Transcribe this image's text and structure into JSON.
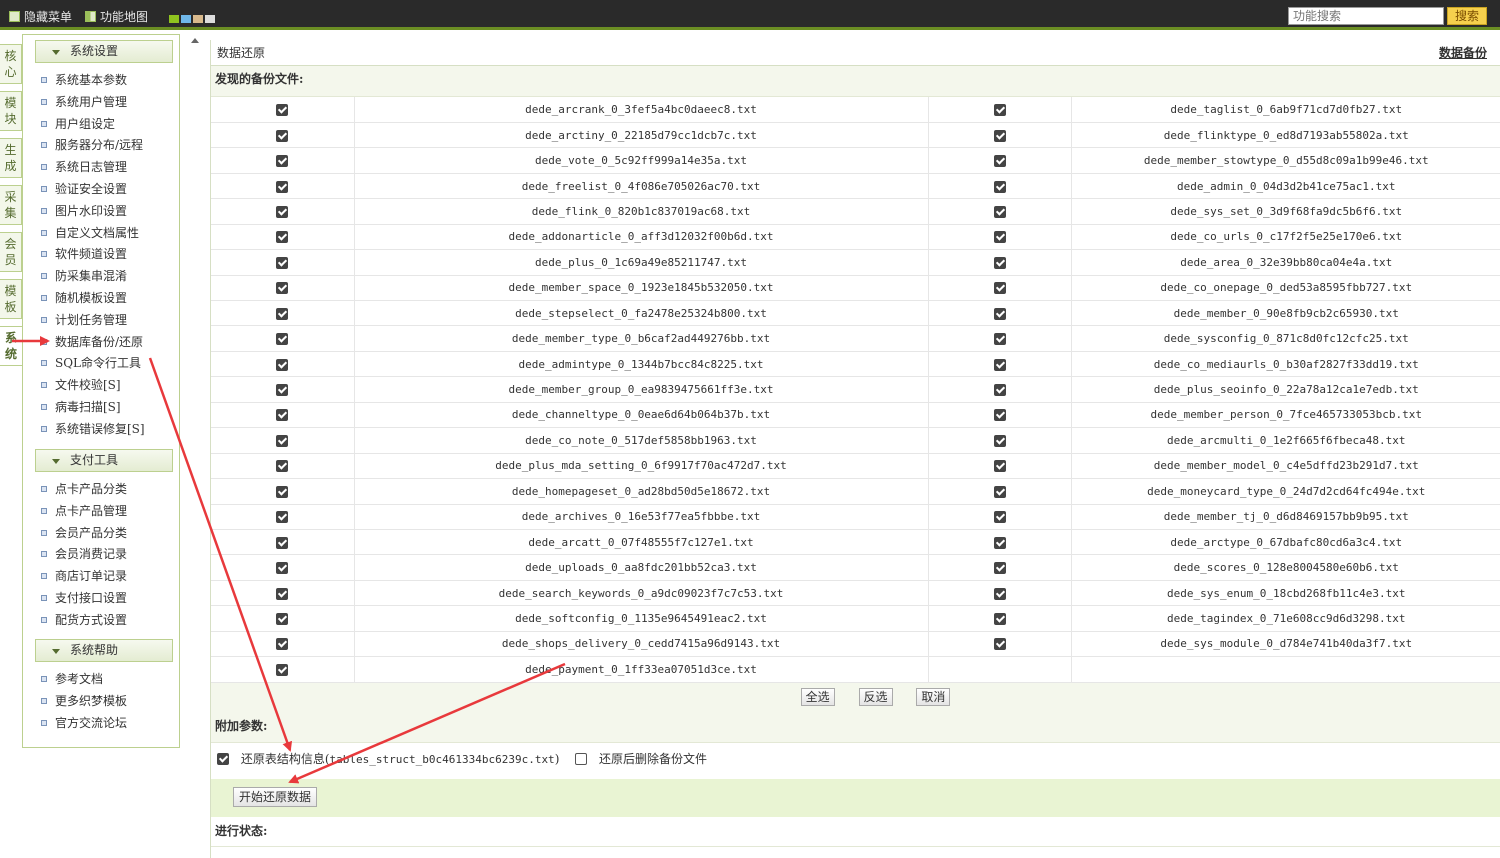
{
  "topbar": {
    "hide_menu": "隐藏菜单",
    "function_map": "功能地图",
    "search_placeholder": "功能搜索",
    "search_button": "搜索",
    "skin_colors": [
      "#8fc31f",
      "#6fb7e9",
      "#d8b98c",
      "#dddddd"
    ]
  },
  "vtabs": [
    "核心",
    "模块",
    "生成",
    "采集",
    "会员",
    "模板",
    "系统"
  ],
  "sidebar": {
    "groups": [
      {
        "title": "系统设置",
        "items": [
          "系统基本参数",
          "系统用户管理",
          "用户组设定",
          "服务器分布/远程",
          "系统日志管理",
          "验证安全设置",
          "图片水印设置",
          "自定义文档属性",
          "软件频道设置",
          "防采集串混淆",
          "随机模板设置",
          "计划任务管理",
          "数据库备份/还原",
          "SQL命令行工具",
          "文件校验[S]",
          "病毒扫描[S]",
          "系统错误修复[S]"
        ]
      },
      {
        "title": "支付工具",
        "items": [
          "点卡产品分类",
          "点卡产品管理",
          "会员产品分类",
          "会员消费记录",
          "商店订单记录",
          "支付接口设置",
          "配货方式设置"
        ]
      },
      {
        "title": "系统帮助",
        "items": [
          "参考文档",
          "更多织梦模板",
          "官方交流论坛"
        ]
      }
    ]
  },
  "main": {
    "title": "数据还原",
    "backup_link": "数据备份",
    "found_label": "发现的备份文件:",
    "files_left": [
      "dede_arcrank_0_3fef5a4bc0daeec8.txt",
      "dede_arctiny_0_22185d79cc1dcb7c.txt",
      "dede_vote_0_5c92ff999a14e35a.txt",
      "dede_freelist_0_4f086e705026ac70.txt",
      "dede_flink_0_820b1c837019ac68.txt",
      "dede_addonarticle_0_aff3d12032f00b6d.txt",
      "dede_plus_0_1c69a49e85211747.txt",
      "dede_member_space_0_1923e1845b532050.txt",
      "dede_stepselect_0_fa2478e25324b800.txt",
      "dede_member_type_0_b6caf2ad449276bb.txt",
      "dede_admintype_0_1344b7bcc84c8225.txt",
      "dede_member_group_0_ea9839475661ff3e.txt",
      "dede_channeltype_0_0eae6d64b064b37b.txt",
      "dede_co_note_0_517def5858bb1963.txt",
      "dede_plus_mda_setting_0_6f9917f70ac472d7.txt",
      "dede_homepageset_0_ad28bd50d5e18672.txt",
      "dede_archives_0_16e53f77ea5fbbbe.txt",
      "dede_arcatt_0_07f48555f7c127e1.txt",
      "dede_uploads_0_aa8fdc201bb52ca3.txt",
      "dede_search_keywords_0_a9dc09023f7c7c53.txt",
      "dede_softconfig_0_1135e9645491eac2.txt",
      "dede_shops_delivery_0_cedd7415a96d9143.txt",
      "dede_payment_0_1ff33ea07051d3ce.txt"
    ],
    "files_right": [
      "dede_taglist_0_6ab9f71cd7d0fb27.txt",
      "dede_flinktype_0_ed8d7193ab55802a.txt",
      "dede_member_stowtype_0_d55d8c09a1b99e46.txt",
      "dede_admin_0_04d3d2b41ce75ac1.txt",
      "dede_sys_set_0_3d9f68fa9dc5b6f6.txt",
      "dede_co_urls_0_c17f2f5e25e170e6.txt",
      "dede_area_0_32e39bb80ca04e4a.txt",
      "dede_co_onepage_0_ded53a8595fbb727.txt",
      "dede_member_0_90e8fb9cb2c65930.txt",
      "dede_sysconfig_0_871c8d0fc12cfc25.txt",
      "dede_co_mediaurls_0_b30af2827f33dd19.txt",
      "dede_plus_seoinfo_0_22a78a12ca1e7edb.txt",
      "dede_member_person_0_7fce465733053bcb.txt",
      "dede_arcmulti_0_1e2f665f6fbeca48.txt",
      "dede_member_model_0_c4e5dffd23b291d7.txt",
      "dede_moneycard_type_0_24d7d2cd64fc494e.txt",
      "dede_member_tj_0_d6d8469157bb9b95.txt",
      "dede_arctype_0_67dbafc80cd6a3c4.txt",
      "dede_scores_0_128e8004580e60b6.txt",
      "dede_sys_enum_0_18cbd268fb11c4e3.txt",
      "dede_tagindex_0_71e608cc9d6d3298.txt",
      "dede_sys_module_0_d784e741b40da3f7.txt"
    ],
    "buttons": {
      "select_all": "全选",
      "invert": "反选",
      "cancel": "取消"
    },
    "params_label": "附加参数:",
    "restore_struct_label": "还原表结构信息(",
    "restore_struct_file": "tables_struct_b0c461334bc6239c.txt",
    "restore_struct_close": ")",
    "delete_after_label": "还原后删除备份文件",
    "start_button": "开始还原数据",
    "status_label": "进行状态:"
  },
  "annotation_color": "#e8393c"
}
